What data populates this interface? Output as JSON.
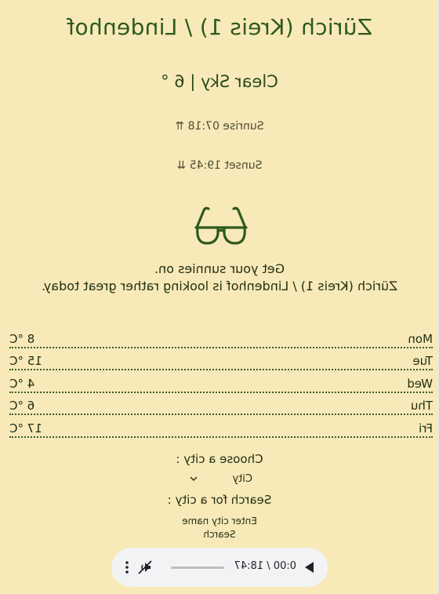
{
  "location": {
    "title": "Zürich (Kreis 1) / Lindenhof"
  },
  "current": {
    "condition": "Clear Sky | 6 °",
    "sunrise": "Sunrise 07:18 ⇈",
    "sunset": "Sunset 19:45 ⇊"
  },
  "message": {
    "line1": "Get your sunnies on.",
    "line2": "Zürich (Kreis 1) / Lindenhof is looking rather great today."
  },
  "icons": {
    "weather": "sunglasses-icon",
    "select_arrow": "chevron-down-icon",
    "play": "play-icon",
    "mute": "volume-muted-icon",
    "more": "more-vertical-icon"
  },
  "forecast": [
    {
      "day": "Mon",
      "temp": "8 °C"
    },
    {
      "day": "Tue",
      "temp": "15 °C"
    },
    {
      "day": "Wed",
      "temp": "4 °C"
    },
    {
      "day": "Thu",
      "temp": "6 °C"
    },
    {
      "day": "Fri",
      "temp": "17 °C"
    }
  ],
  "city_chooser": {
    "label": "Choose a city :",
    "selected": "City"
  },
  "city_search": {
    "label": "Search for a city :",
    "placeholder": "Enter city name",
    "button": "Search"
  },
  "audio_player": {
    "time": "0:00 / 18:47",
    "progress": 0
  },
  "colors": {
    "background": "#f8e9b8",
    "title": "#2d5a1d",
    "text": "#1f2e12",
    "player_bg": "#f1f3f4"
  }
}
